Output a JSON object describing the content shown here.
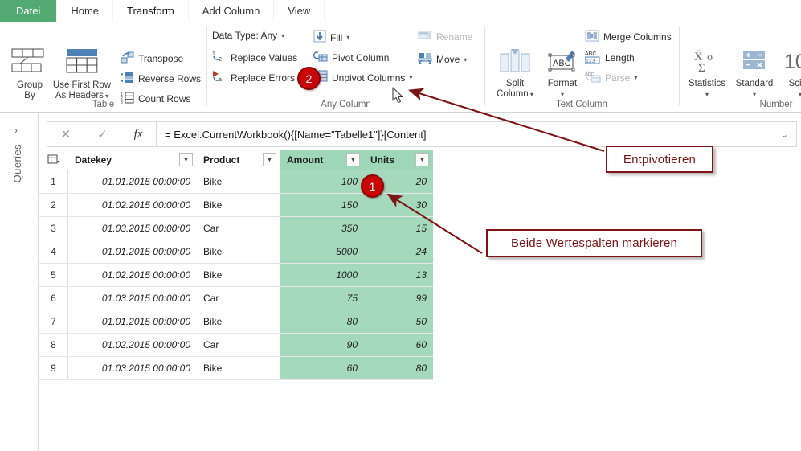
{
  "tabs": [
    {
      "label": "Datei",
      "kind": "file"
    },
    {
      "label": "Home",
      "kind": "normal"
    },
    {
      "label": "Transform",
      "kind": "active"
    },
    {
      "label": "Add Column",
      "kind": "normal"
    },
    {
      "label": "View",
      "kind": "normal"
    }
  ],
  "ribbon": {
    "groups": [
      {
        "label": "Table"
      },
      {
        "label": "Any Column"
      },
      {
        "label": "Text Column"
      },
      {
        "label": "Number"
      }
    ],
    "table_group": {
      "group_by": "Group\nBy",
      "group_by_line1": "Group",
      "group_by_line2": "By",
      "use_first_row_line1": "Use First Row",
      "use_first_row_line2": "As Headers",
      "transpose": "Transpose",
      "reverse_rows": "Reverse Rows",
      "count_rows": "Count Rows"
    },
    "any_column_group": {
      "data_type": "Data Type: Any",
      "replace_values": "Replace Values",
      "replace_errors": "Replace Errors",
      "fill": "Fill",
      "pivot_column": "Pivot Column",
      "unpivot_columns": "Unpivot Columns",
      "rename": "Rename",
      "move": "Move"
    },
    "text_column_group": {
      "split_column_line1": "Split",
      "split_column_line2": "Column",
      "format": "Format",
      "merge_columns": "Merge Columns",
      "length": "Length",
      "parse": "Parse",
      "format_icon_text": "ABC",
      "length_icon_top": "ABC",
      "length_icon_bottom": "123",
      "parse_icon_text": "abc"
    },
    "number_group": {
      "statistics": "Statistics",
      "standard": "Standard",
      "scientific": "Scien",
      "statistics_icon": "Xσ\nΣ",
      "scientific_icon": "10"
    }
  },
  "rail": {
    "chevron": "›",
    "label": "Queries"
  },
  "formula_bar": {
    "cancel_icon": "✕",
    "accept_icon": "✓",
    "fx_icon": "fx",
    "value": "= Excel.CurrentWorkbook(){[Name=\"Tabelle1\"]}[Content]",
    "expand_icon": "⌄"
  },
  "grid": {
    "columns": [
      {
        "key": "rownum",
        "label": "",
        "selected": false,
        "filter": false
      },
      {
        "key": "datekey",
        "label": "Datekey",
        "selected": false,
        "filter": true
      },
      {
        "key": "product",
        "label": "Product",
        "selected": false,
        "filter": true
      },
      {
        "key": "amount",
        "label": "Amount",
        "selected": true,
        "filter": true
      },
      {
        "key": "units",
        "label": "Units",
        "selected": true,
        "filter": true
      }
    ],
    "rows": [
      {
        "n": "1",
        "datekey": "01.01.2015 00:00:00",
        "product": "Bike",
        "amount": "100",
        "units": "20"
      },
      {
        "n": "2",
        "datekey": "01.02.2015 00:00:00",
        "product": "Bike",
        "amount": "150",
        "units": "30"
      },
      {
        "n": "3",
        "datekey": "01.03.2015 00:00:00",
        "product": "Car",
        "amount": "350",
        "units": "15"
      },
      {
        "n": "4",
        "datekey": "01.01.2015 00:00:00",
        "product": "Bike",
        "amount": "5000",
        "units": "24"
      },
      {
        "n": "5",
        "datekey": "01.02.2015 00:00:00",
        "product": "Bike",
        "amount": "1000",
        "units": "13"
      },
      {
        "n": "6",
        "datekey": "01.03.2015 00:00:00",
        "product": "Car",
        "amount": "75",
        "units": "99"
      },
      {
        "n": "7",
        "datekey": "01.01.2015 00:00:00",
        "product": "Bike",
        "amount": "80",
        "units": "50"
      },
      {
        "n": "8",
        "datekey": "01.02.2015 00:00:00",
        "product": "Car",
        "amount": "90",
        "units": "60"
      },
      {
        "n": "9",
        "datekey": "01.03.2015 00:00:00",
        "product": "Bike",
        "amount": "60",
        "units": "80"
      }
    ]
  },
  "annotations": {
    "callout_unpivot": "Entpivotieren",
    "callout_select": "Beide Wertespalten markieren",
    "badge_step1": "1",
    "badge_step2": "2"
  },
  "colors": {
    "file_tab": "#52aa72",
    "selection_header": "#9ed6b8",
    "selection_cell": "#a5d9bc",
    "annotation": "#7d1416",
    "badge": "#cc0506"
  }
}
